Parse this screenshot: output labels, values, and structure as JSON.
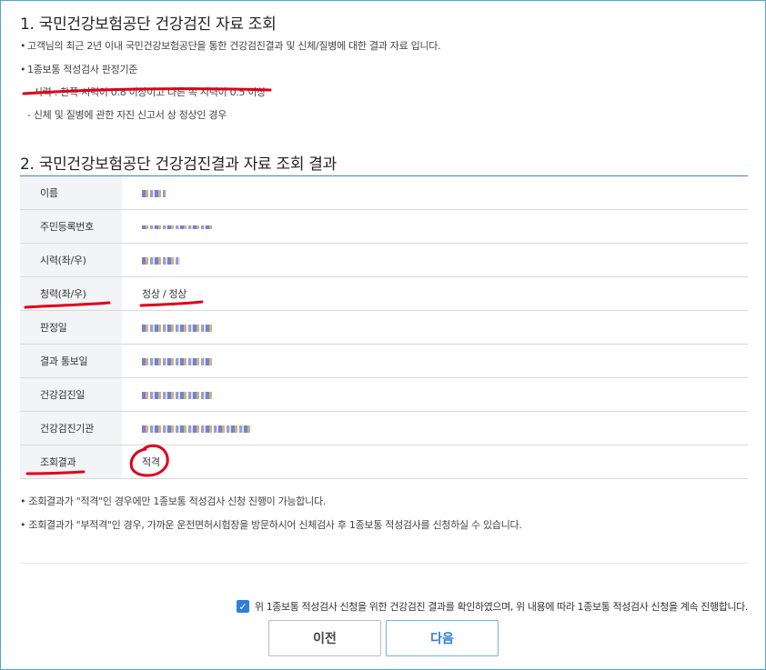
{
  "section1": {
    "title": "1. 국민건강보험공단 건강검진 자료 조회",
    "bullets": [
      "고객님의 최근 2년 이내 국민건강보험공단을 통한 건강검진결과 및 신체/질병에 대한 결과 자료 입니다.",
      "1종보통 적성검사 판정기준"
    ],
    "criteria": [
      "- 시력 : 한쪽 시력이 0.8 이상이고 다른 쪽 시력이 0.5 이상",
      "- 신체 및 질병에 관한 자진 신고서 상 정상인 경우"
    ]
  },
  "section2": {
    "title": "2. 국민건강보험공단 건강검진결과 자료 조회 결과",
    "rows": [
      {
        "label": "이름",
        "value": ""
      },
      {
        "label": "주민등록번호",
        "value": ""
      },
      {
        "label": "시력(좌/우)",
        "value": ""
      },
      {
        "label": "청력(좌/우)",
        "value": "정상 / 정상"
      },
      {
        "label": "판정일",
        "value": ""
      },
      {
        "label": "결과 통보일",
        "value": ""
      },
      {
        "label": "건강검진일",
        "value": ""
      },
      {
        "label": "건강검진기관",
        "value": ""
      },
      {
        "label": "조회결과",
        "value": "적격"
      }
    ]
  },
  "notes": [
    "조회결과가 \"적격\"인 경우에만 1종보통 적성검사 신청 진행이 가능합니다.",
    "조회결과가 \"부적격\"인 경우, 가까운 운전면허시험장을 방문하시어 신체검사 후 1종보통 적성검사를 신청하실 수 있습니다."
  ],
  "agreement": {
    "checked": true,
    "text": "위 1종보통 적성검사 신청을 위한 건강검진 결과를 확인하였으며, 위 내용에 따라 1종보통 적성검사 신청을 계속 진행합니다."
  },
  "buttons": {
    "prev_label": "이전",
    "next_label": "다음"
  },
  "colors": {
    "accent": "#2f7ed8",
    "table_border": "#3b87c4",
    "label_bg": "#f3f4f6",
    "annotation_ink": "#e0001a",
    "result_text": "#1f5fbf"
  },
  "icons": {
    "checkbox": "checkmark-icon"
  }
}
